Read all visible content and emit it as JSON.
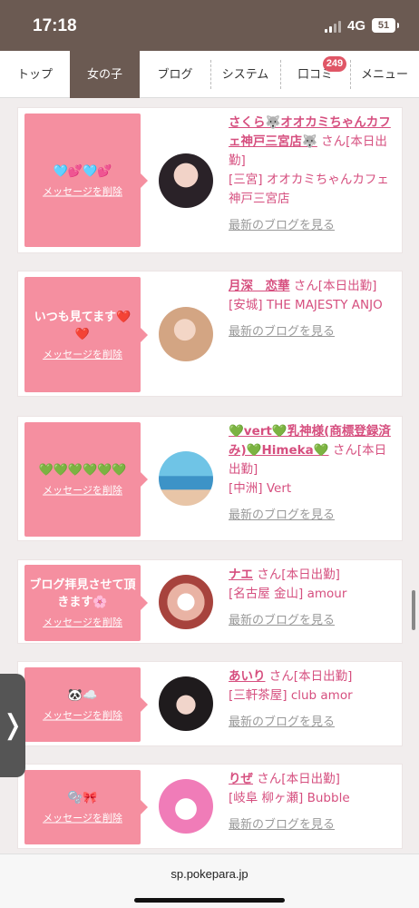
{
  "status": {
    "time": "17:18",
    "network": "4G",
    "battery": "51"
  },
  "nav": {
    "tabs": [
      {
        "label": "トップ"
      },
      {
        "label": "女の子"
      },
      {
        "label": "ブログ"
      },
      {
        "label": "システム"
      },
      {
        "label": "口コミ"
      },
      {
        "label": "メニュー"
      }
    ],
    "reviews_badge": "249"
  },
  "delete_label": "メッセージを削除",
  "blog_link_label": "最新のブログを見る",
  "san_label": "さん",
  "cards": [
    {
      "message": "🩵💕🩵💕",
      "name": "さくら🐺オオカミちゃんカフェ神戸三宮店🐺",
      "status": "[本日出勤]",
      "shop": "[三宮] オオカミちゃんカフェ神戸三宮店"
    },
    {
      "message": "いつも見てます❤️❤️",
      "name": "月深　恋華",
      "status": "[本日出勤]",
      "shop": "[安城] THE MAJESTY ANJO"
    },
    {
      "message": "💚💚💚💚💚💚",
      "name": "💚vert💚乳神様(商標登録済み)💚Himeka💚",
      "status": "[本日出勤]",
      "shop": "[中洲] Vert"
    },
    {
      "message": "ブログ拝見させて頂きます🌸",
      "name": "ナエ",
      "status": "[本日出勤]",
      "shop": "[名古屋 金山] amour"
    },
    {
      "message": "🐼☁️",
      "name": "あいり",
      "status": "[本日出勤]",
      "shop": "[三軒茶屋] club amor"
    },
    {
      "message": "🫧🎀",
      "name": "りぜ",
      "status": "[本日出勤]",
      "shop": "[岐阜 柳ヶ瀬] Bubble"
    }
  ],
  "bottom": {
    "url": "sp.pokepara.jp"
  }
}
